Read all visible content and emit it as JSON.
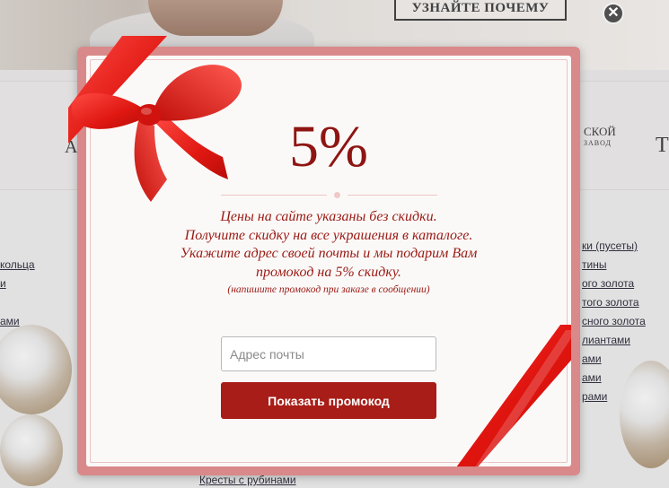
{
  "background": {
    "cta_label": "УЗНАЙТЕ ПОЧЕМУ",
    "brands": [
      {
        "text": "А",
        "name": "brand-a"
      },
      {
        "text": "СКОЙ",
        "sub": "ЗАВОД",
        "name": "brand-skoy"
      },
      {
        "text": "Т",
        "name": "brand-t"
      }
    ],
    "left_links": [
      "кольца",
      "и",
      "ами"
    ],
    "right_links": [
      "ки (пусеты)",
      "тины",
      "ого золота",
      "того золота",
      "сного золота",
      "лиантами",
      "ами",
      "рами",
      "ами"
    ],
    "bottom_link": "Кресты с рубинами"
  },
  "modal": {
    "discount": "5%",
    "message_lines": [
      "Цены на сайте указаны без скидки.",
      "Получите скидку на все украшения в каталоге.",
      "Укажите адрес своей почты и мы подарим Вам",
      "промокод на 5% скидку."
    ],
    "hint": "(напишите промокод при заказе в сообщении)",
    "email_placeholder": "Адрес почты",
    "email_value": "",
    "submit_label": "Показать промокод",
    "close_glyph": "✕"
  },
  "colors": {
    "accent": "#a81d17",
    "text_red": "#9a1a14",
    "frame": "#d98989"
  }
}
